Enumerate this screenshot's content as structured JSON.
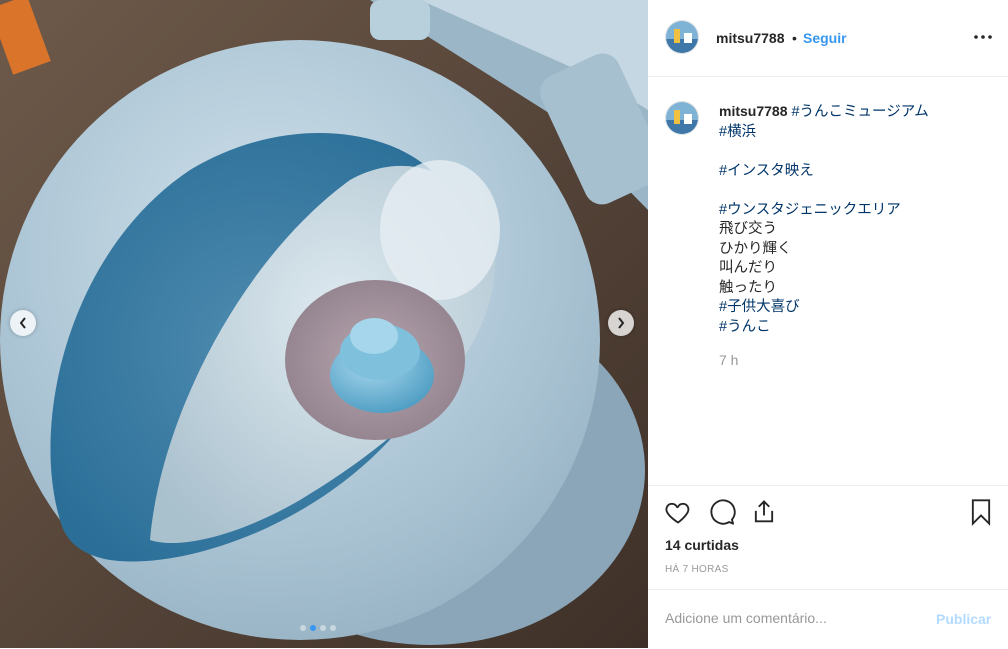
{
  "post": {
    "username": "mitsu7788",
    "separator": "•",
    "follow_label": "Seguir",
    "more_icon": "more-horizontal-icon"
  },
  "caption": {
    "username": "mitsu7788",
    "tag1": "#うんこミュージアム",
    "tag2": "#横浜",
    "tag3": "#インスタ映え",
    "tag4": "#ウンスタジェニックエリア",
    "text1": "飛び交う",
    "text2": "ひかり輝く",
    "text3": "叫んだり",
    "text4": "触ったり",
    "tag5": "#子供大喜び",
    "tag6": "#うんこ"
  },
  "comment_time": "7 h",
  "actions": {
    "icons": [
      "heart-icon",
      "comment-icon",
      "share-icon",
      "bookmark-icon"
    ],
    "likes": "14 curtidas",
    "ago": "HÁ 7 HORAS"
  },
  "add_comment": {
    "placeholder": "Adicione um comentário...",
    "publish_label": "Publicar"
  },
  "carousel": {
    "slide_count": 4,
    "active_index": 1
  },
  "colors": {
    "link": "#3897f0",
    "hashtag": "#003569",
    "muted": "#999999",
    "publish_disabled": "#b3dbff"
  }
}
